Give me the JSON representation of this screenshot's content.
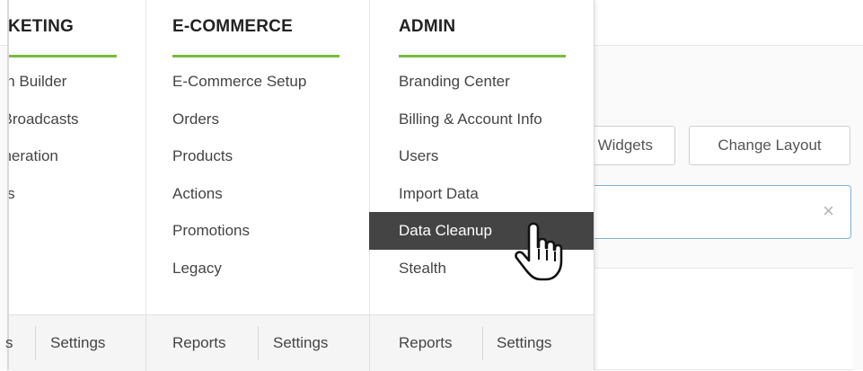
{
  "background": {
    "widgets_button_label": "Widgets",
    "change_layout_button_label": "Change Layout",
    "search_clear_glyph": "×"
  },
  "menu": {
    "columns": [
      {
        "id": "marketing",
        "title": "KETING",
        "items": [
          "ign Builder",
          "l Broadcasts",
          "eneration",
          "tes"
        ],
        "footer": [
          "s",
          "Settings"
        ]
      },
      {
        "id": "ecommerce",
        "title": "E-COMMERCE",
        "items": [
          "E-Commerce Setup",
          "Orders",
          "Products",
          "Actions",
          "Promotions",
          "Legacy"
        ],
        "footer": [
          "Reports",
          "Settings"
        ]
      },
      {
        "id": "admin",
        "title": "ADMIN",
        "items": [
          "Branding Center",
          "Billing & Account Info",
          "Users",
          "Import Data",
          "Data Cleanup",
          "Stealth"
        ],
        "active_item": "Data Cleanup",
        "footer": [
          "Reports",
          "Settings"
        ]
      }
    ]
  },
  "colors": {
    "accent_rule": "#76bd3d",
    "active_item_bg": "#444444",
    "active_item_text": "#ffffff",
    "search_border": "#7fb0d6"
  },
  "icons": {
    "cursor": "hand-pointer-icon",
    "clear": "close-icon"
  }
}
